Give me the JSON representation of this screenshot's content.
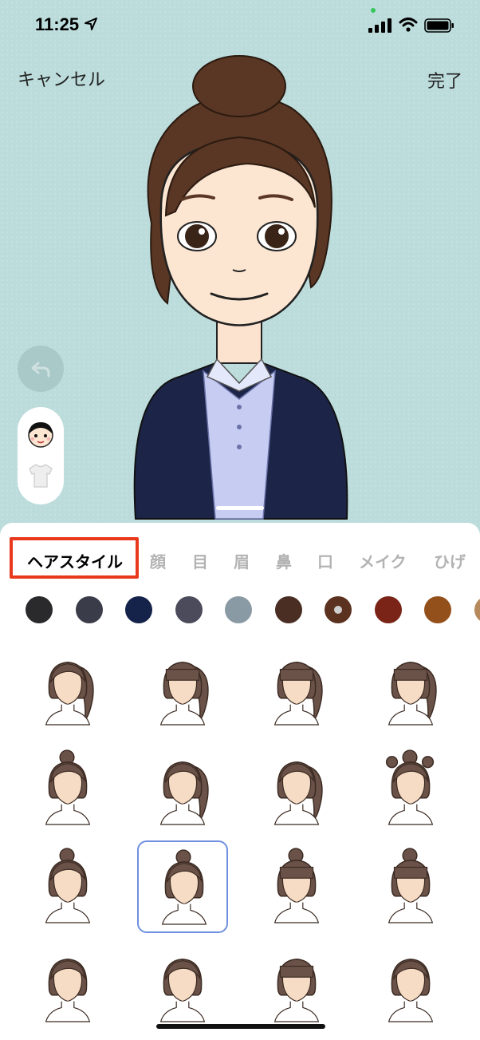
{
  "status": {
    "time": "11:25"
  },
  "nav": {
    "cancel_label": "キャンセル",
    "done_label": "完了"
  },
  "tabs": [
    {
      "label": "ヘアスタイル",
      "active": true
    },
    {
      "label": "顔"
    },
    {
      "label": "目"
    },
    {
      "label": "眉"
    },
    {
      "label": "鼻"
    },
    {
      "label": "口"
    },
    {
      "label": "メイク"
    },
    {
      "label": "ひげ"
    }
  ],
  "hair_colors": [
    "#2a2a2c",
    "#3a3c4a",
    "#15224a",
    "#4b4b5b",
    "#8a9aa4",
    "#4a2e24",
    "#5a321f",
    "#7a2418",
    "#94501b",
    "#b68a5c"
  ],
  "selected_color_index": 6,
  "hairstyles": {
    "selected_index": 9,
    "count": 16
  },
  "icons": {
    "undo": "undo-icon",
    "face_mode": "face-mode-icon",
    "clothing_mode": "shirt-icon",
    "location": "location-arrow-icon",
    "signal": "cellular-signal-icon",
    "wifi": "wifi-icon",
    "battery": "battery-icon"
  }
}
